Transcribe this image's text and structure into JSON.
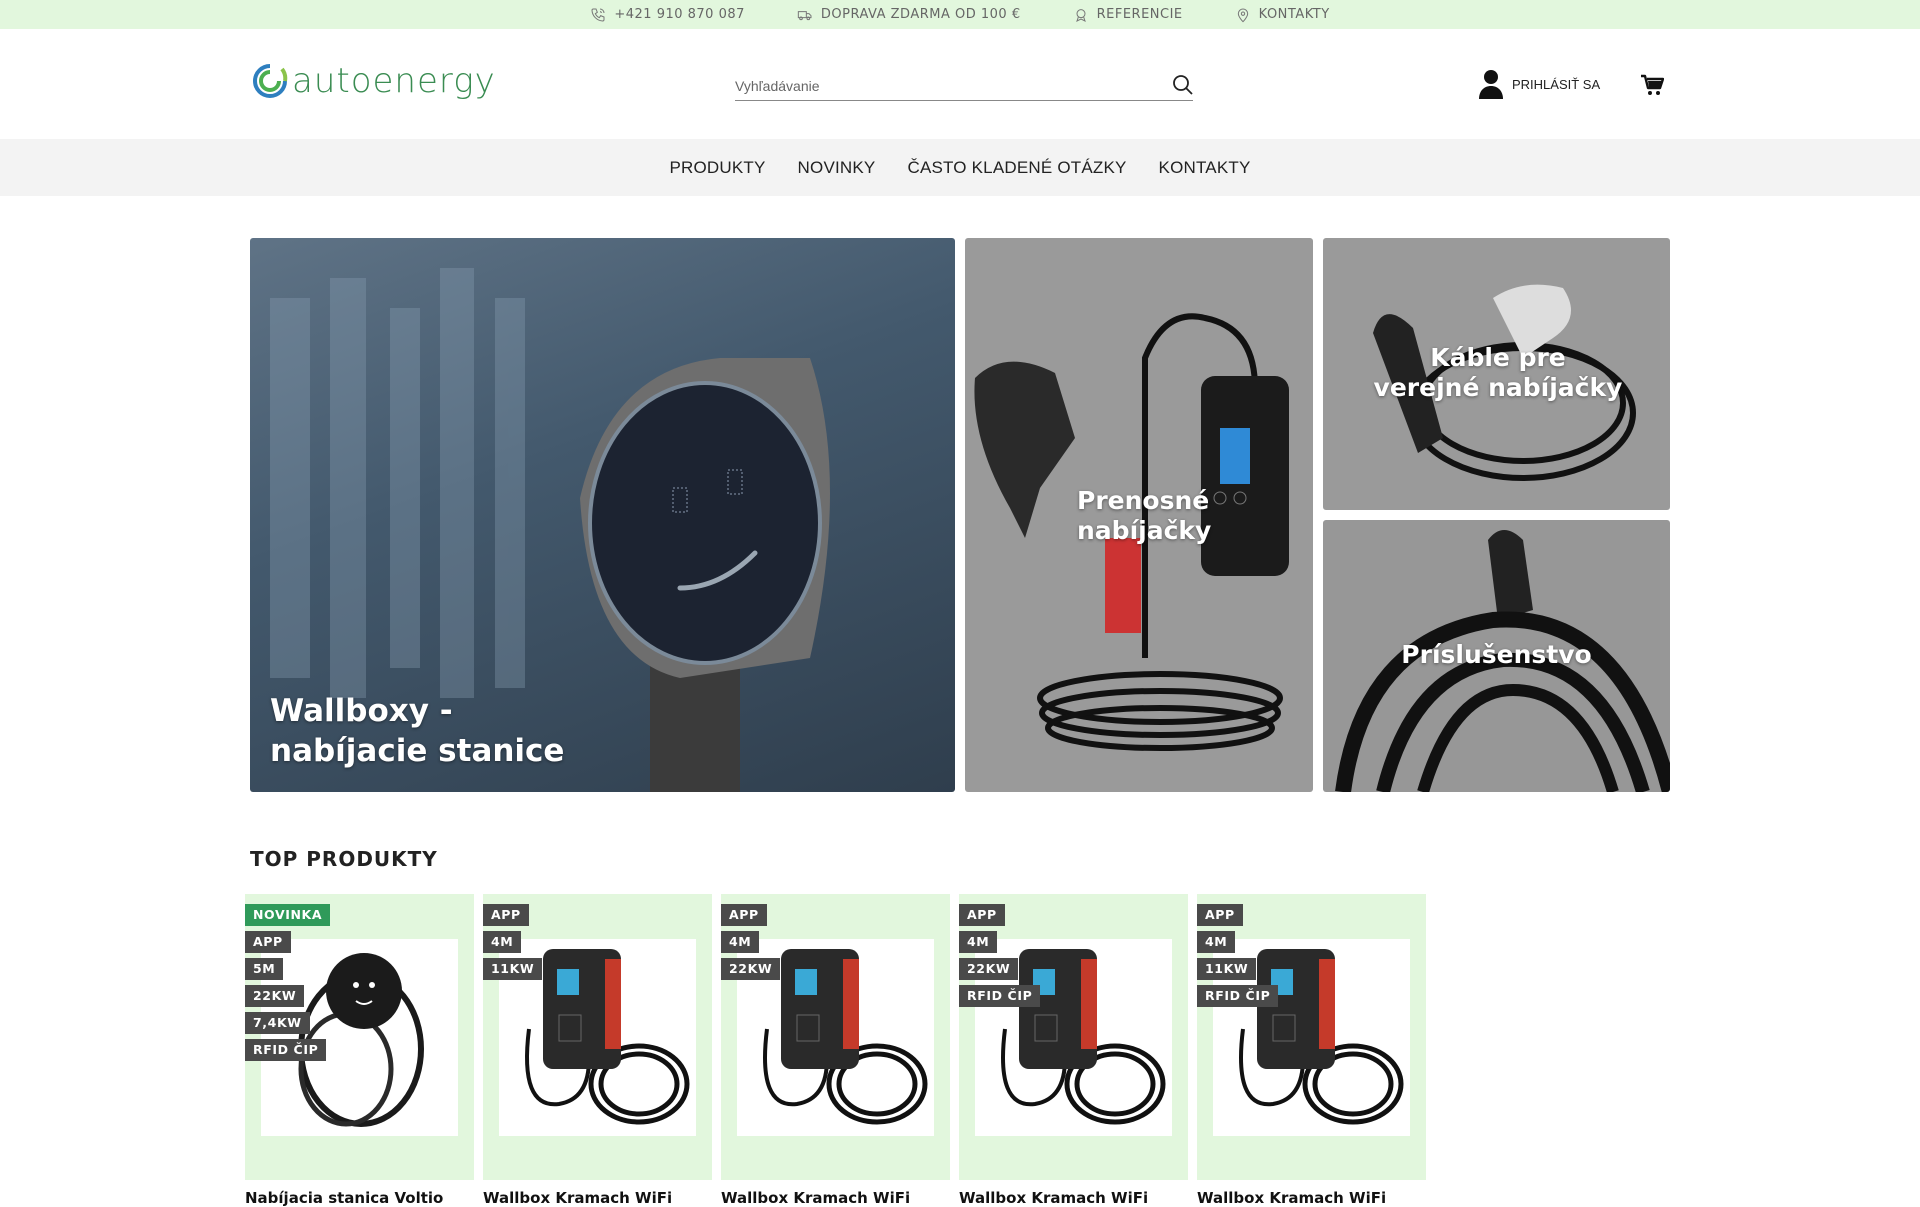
{
  "topbar": {
    "items": [
      {
        "icon": "phone-icon",
        "label": "+421 910 870 087"
      },
      {
        "icon": "truck-icon",
        "label": "DOPRAVA ZDARMA OD 100 €"
      },
      {
        "icon": "award-icon",
        "label": "REFERENCIE"
      },
      {
        "icon": "location-icon",
        "label": "KONTAKTY"
      }
    ]
  },
  "header": {
    "logo_text": "autoenergy",
    "search_placeholder": "Vyhľadávanie",
    "login_label": "PRIHLÁSIŤ SA"
  },
  "nav": {
    "items": [
      "PRODUKTY",
      "NOVINKY",
      "ČASTO KLADENÉ OTÁZKY",
      "KONTAKTY"
    ]
  },
  "hero": {
    "main": "Wallboxy - nabíjacie stanice",
    "portable": "Prenosné nabíjačky",
    "cables": "Káble pre verejné nabíjačky",
    "accessories": "Príslušenstvo"
  },
  "top_products": {
    "title": "TOP PRODUKTY",
    "items": [
      {
        "badges": [
          "NOVINKA",
          "APP",
          "5M",
          "22KW",
          "7,4KW",
          "RFID ČIP"
        ],
        "name": "Nabíjacia stanica Voltio"
      },
      {
        "badges": [
          "APP",
          "4M",
          "11KW"
        ],
        "name": "Wallbox Kramach WiFi"
      },
      {
        "badges": [
          "APP",
          "4M",
          "22KW"
        ],
        "name": "Wallbox Kramach WiFi"
      },
      {
        "badges": [
          "APP",
          "4M",
          "22KW",
          "RFID ČIP"
        ],
        "name": "Wallbox Kramach WiFi"
      },
      {
        "badges": [
          "APP",
          "4M",
          "11KW",
          "RFID ČIP"
        ],
        "name": "Wallbox Kramach WiFi"
      }
    ]
  },
  "colors": {
    "accent_green": "#2f9a5a",
    "topbar_bg": "#e2f7dd",
    "product_bg": "#e2f7dd",
    "badge_dark": "#4a4a4a"
  }
}
